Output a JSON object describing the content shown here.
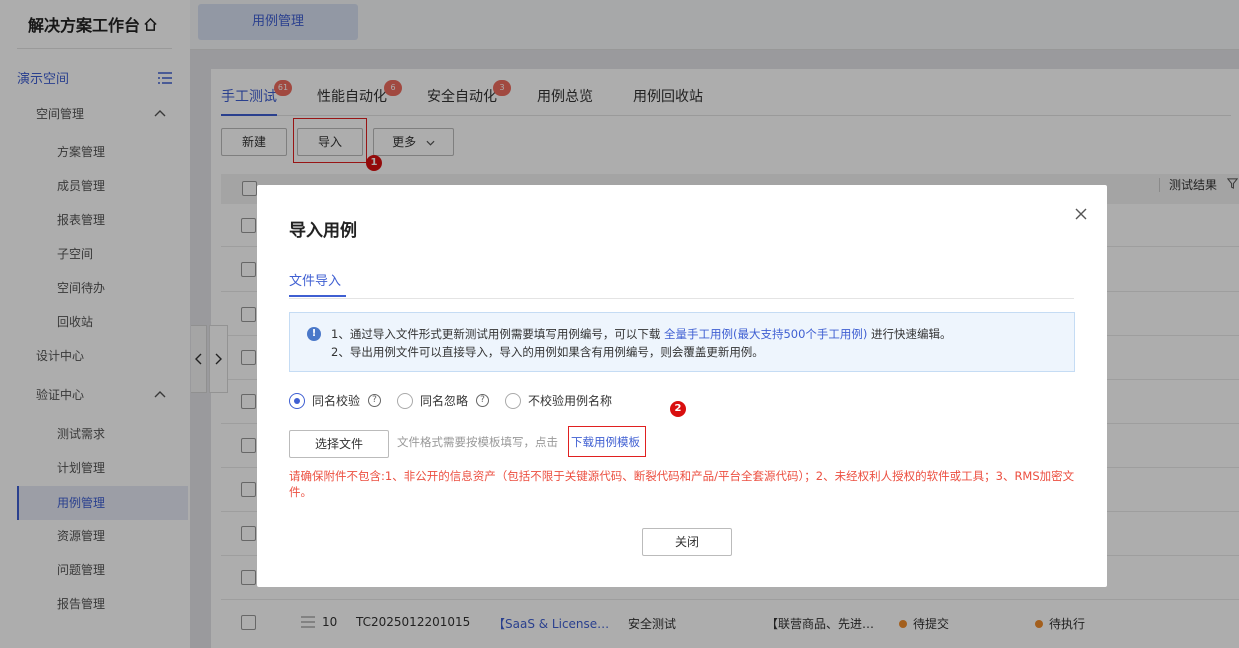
{
  "sidebar": {
    "title": "解决方案工作台",
    "workspace": "演示空间",
    "items": [
      {
        "label": "空间管理",
        "level": 1,
        "expanded": true
      },
      {
        "label": "方案管理",
        "level": 2
      },
      {
        "label": "成员管理",
        "level": 2
      },
      {
        "label": "报表管理",
        "level": 2
      },
      {
        "label": "子空间",
        "level": 2
      },
      {
        "label": "空间待办",
        "level": 2
      },
      {
        "label": "回收站",
        "level": 2
      },
      {
        "label": "设计中心",
        "level": 1
      },
      {
        "label": "验证中心",
        "level": 1,
        "expanded": true
      },
      {
        "label": "测试需求",
        "level": 2
      },
      {
        "label": "计划管理",
        "level": 2
      },
      {
        "label": "用例管理",
        "level": 2,
        "active": true
      },
      {
        "label": "资源管理",
        "level": 2
      },
      {
        "label": "问题管理",
        "level": 2
      },
      {
        "label": "报告管理",
        "level": 2
      }
    ]
  },
  "topbar": {
    "tab": "用例管理"
  },
  "tabs": [
    {
      "label": "手工测试",
      "badge": "61",
      "active": true
    },
    {
      "label": "性能自动化",
      "badge": "6"
    },
    {
      "label": "安全自动化",
      "badge": "3"
    },
    {
      "label": "用例总览"
    },
    {
      "label": "用例回收站"
    }
  ],
  "toolbar": {
    "new": "新建",
    "import": "导入",
    "more": "更多"
  },
  "table": {
    "last_header": "测试结果",
    "last_row": {
      "num": "10",
      "id": "TC2025012201015",
      "name": "【SaaS & License…",
      "type": "安全测试",
      "desc": "【联营商品、先进…",
      "status1": "待提交",
      "status2": "待执行"
    }
  },
  "annotations": {
    "n1": "1",
    "n2": "2"
  },
  "dialog": {
    "title": "导入用例",
    "tab": "文件导入",
    "info_line1_pre": "1、通过导入文件形式更新测试用例需要填写用例编号，可以下载 ",
    "info_line1_link": "全量手工用例(最大支持500个手工用例)",
    "info_line1_post": " 进行快速编辑。",
    "info_line2": "2、导出用例文件可以直接导入，导入的用例如果含有用例编号，则会覆盖更新用例。",
    "radios": [
      {
        "label": "同名校验",
        "help": "?",
        "checked": true
      },
      {
        "label": "同名忽略",
        "help": "?",
        "checked": false
      },
      {
        "label": "不校验用例名称",
        "checked": false
      }
    ],
    "select_file": "选择文件",
    "file_hint": "文件格式需要按模板填写，点击",
    "download_template": "下载用例模板",
    "warning": "请确保附件不包含:1、非公开的信息资产（包括不限于关键源代码、断裂代码和产品/平台全套源代码）；2、未经权利人授权的软件或工具；3、RMS加密文件。",
    "close_button": "关闭"
  },
  "colors": {
    "accent": "#3f5fd2",
    "badge": "#ee6c5f",
    "warning": "#ec4f40",
    "annotation": "#d90f0f"
  },
  "icons": [
    "home-icon",
    "list-icon",
    "chevron-up-icon",
    "chevron-left-icon",
    "chevron-right-icon",
    "chevron-down-icon",
    "close-icon",
    "info-icon",
    "filter-icon",
    "drag-handle-icon"
  ]
}
